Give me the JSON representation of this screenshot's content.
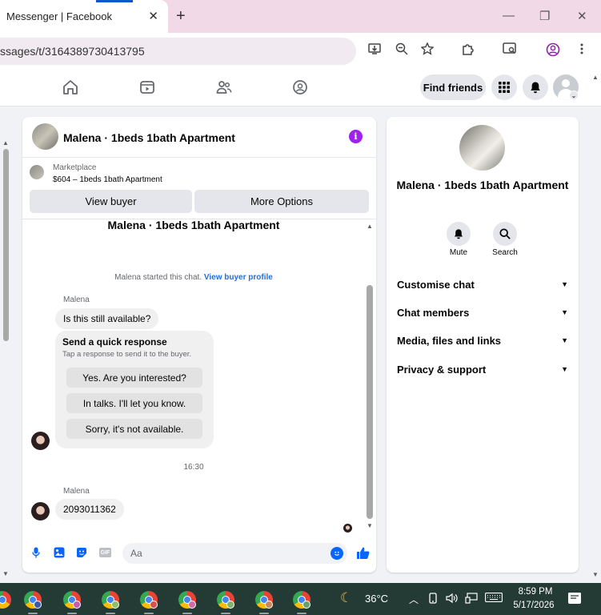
{
  "browser": {
    "tab_title": "Messenger | Facebook",
    "tab_close": "✕",
    "new_tab": "+",
    "url": "ssages/t/3164389730413795",
    "window_minimize": "—",
    "window_restore": "❐",
    "window_close": "✕"
  },
  "fbnav": {
    "find_friends": "Find friends"
  },
  "chat": {
    "header_title": "Malena · 1beds 1bath Apartment",
    "info_glyph": "i",
    "marketplace_label": "Marketplace",
    "listing_text": "$604 – 1beds 1bath Apartment",
    "view_buyer": "View buyer",
    "more_options": "More Options",
    "convo_title": "Malena · 1beds 1bath Apartment",
    "started_text": "Malena started this chat.",
    "view_buyer_profile": "View buyer profile",
    "messages": [
      {
        "sender": "Malena",
        "text": "Is this still available?"
      },
      {
        "sender": "Malena",
        "text": "2093011362"
      }
    ],
    "quick_response": {
      "title": "Send a quick response",
      "subtitle": "Tap a response to send it to the buyer.",
      "options": [
        "Yes. Are you interested?",
        "In talks. I'll let you know.",
        "Sorry, it's not available."
      ]
    },
    "timestamp": "16:30",
    "gif_label": "GIF",
    "composer_placeholder": "Aa"
  },
  "rpanel": {
    "name": "Malena · 1beds 1bath Apartment",
    "mute_label": "Mute",
    "search_label": "Search",
    "rows": [
      "Customise chat",
      "Chat members",
      "Media, files and links",
      "Privacy & support"
    ]
  },
  "taskbar": {
    "temperature": "36°C",
    "time": "8:59 PM",
    "date": "5/17/2026"
  },
  "colors": {
    "accent_blue": "#0866ff",
    "info_purple": "#a020f0",
    "link_blue": "#216fdb",
    "taskbar_bg": "#243a34",
    "tabbar_bg": "#f1d9e8"
  }
}
